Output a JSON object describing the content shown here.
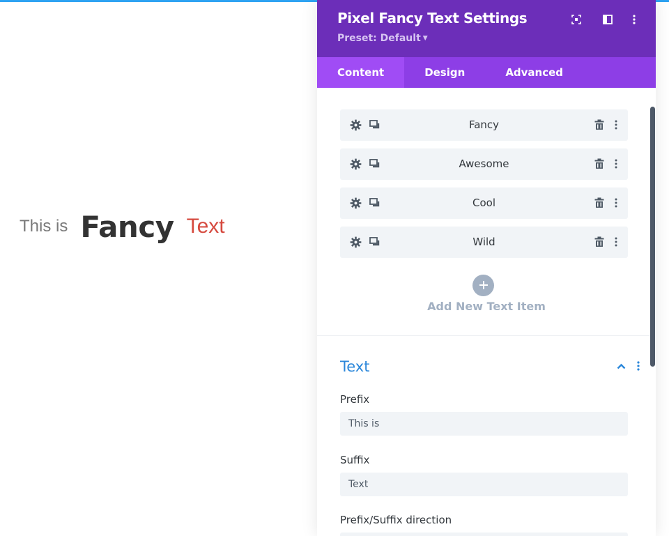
{
  "preview": {
    "prefix": "This is",
    "fancy_word": "Fancy",
    "suffix": "Text"
  },
  "panel": {
    "title": "Pixel Fancy Text Settings",
    "preset_label": "Preset: Default",
    "tabs": [
      {
        "label": "Content",
        "active": true
      },
      {
        "label": "Design",
        "active": false
      },
      {
        "label": "Advanced",
        "active": false
      }
    ],
    "text_items": [
      {
        "label": "Fancy"
      },
      {
        "label": "Awesome"
      },
      {
        "label": "Cool"
      },
      {
        "label": "Wild"
      }
    ],
    "add_item_label": "Add New Text Item",
    "text_section": {
      "title": "Text",
      "fields": {
        "prefix": {
          "label": "Prefix",
          "value": "This is"
        },
        "suffix": {
          "label": "Suffix",
          "value": "Text"
        },
        "direction": {
          "label": "Prefix/Suffix direction"
        }
      }
    }
  },
  "icons": {
    "header": [
      "expand-icon",
      "split-view-icon",
      "more-vertical-icon"
    ],
    "item": [
      "gear-icon",
      "duplicate-icon",
      "trash-icon",
      "more-vertical-icon"
    ],
    "add": "plus-icon",
    "section": [
      "chevron-up-icon",
      "more-vertical-icon"
    ]
  },
  "colors": {
    "header_purple": "#6c2eb9",
    "tab_bar_purple": "#8d3ee6",
    "active_tab_purple": "#a04cf5",
    "accent_blue": "#2b87da",
    "suffix_red": "#d64a3f"
  }
}
